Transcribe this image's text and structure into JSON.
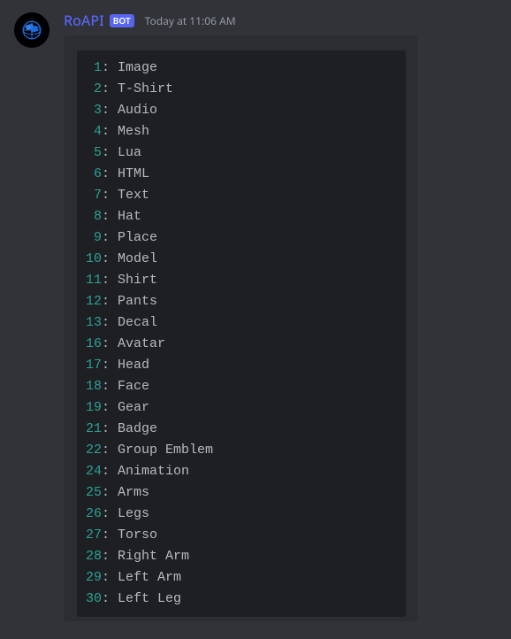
{
  "message": {
    "username": "RoAPI",
    "bot_tag": "BOT",
    "timestamp": "Today at 11:06 AM"
  },
  "code_items": [
    {
      "num": "1",
      "label": "Image"
    },
    {
      "num": "2",
      "label": "T-Shirt"
    },
    {
      "num": "3",
      "label": "Audio"
    },
    {
      "num": "4",
      "label": "Mesh"
    },
    {
      "num": "5",
      "label": "Lua"
    },
    {
      "num": "6",
      "label": "HTML"
    },
    {
      "num": "7",
      "label": "Text"
    },
    {
      "num": "8",
      "label": "Hat"
    },
    {
      "num": "9",
      "label": "Place"
    },
    {
      "num": "10",
      "label": "Model"
    },
    {
      "num": "11",
      "label": "Shirt"
    },
    {
      "num": "12",
      "label": "Pants"
    },
    {
      "num": "13",
      "label": "Decal"
    },
    {
      "num": "16",
      "label": "Avatar"
    },
    {
      "num": "17",
      "label": "Head"
    },
    {
      "num": "18",
      "label": "Face"
    },
    {
      "num": "19",
      "label": "Gear"
    },
    {
      "num": "21",
      "label": "Badge"
    },
    {
      "num": "22",
      "label": "Group Emblem"
    },
    {
      "num": "24",
      "label": "Animation"
    },
    {
      "num": "25",
      "label": "Arms"
    },
    {
      "num": "26",
      "label": "Legs"
    },
    {
      "num": "27",
      "label": "Torso"
    },
    {
      "num": "28",
      "label": "Right Arm"
    },
    {
      "num": "29",
      "label": "Left Arm"
    },
    {
      "num": "30",
      "label": "Left Leg"
    }
  ]
}
